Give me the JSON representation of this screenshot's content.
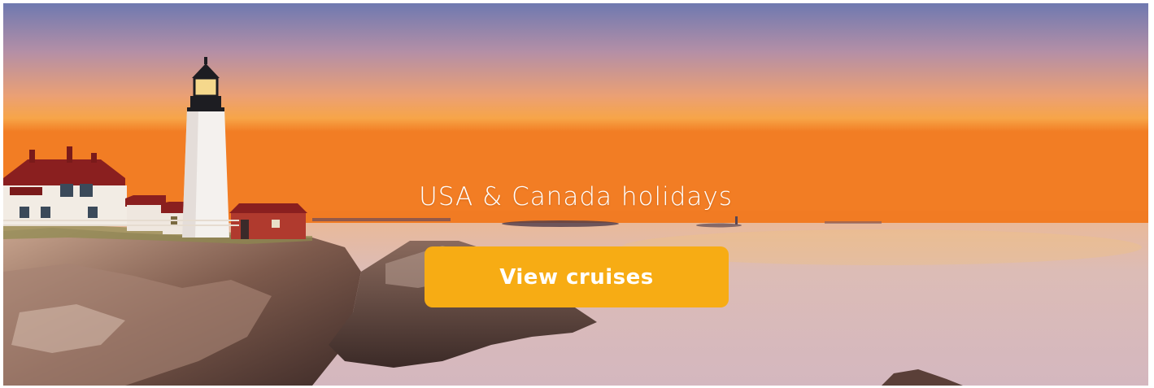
{
  "hero": {
    "headline": "USA & Canada holidays",
    "cta_label": "View cruises"
  },
  "colors": {
    "cta_background": "#f7ac14",
    "cta_text": "#ffffff",
    "headline_text": "#ffffff"
  }
}
